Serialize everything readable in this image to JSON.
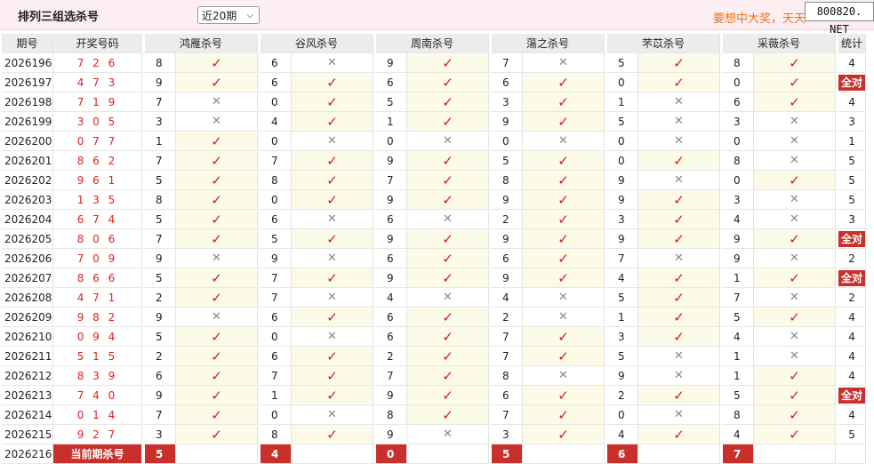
{
  "header": {
    "title": "排列三组选杀号",
    "period": "近20期",
    "slogan": "要想中大奖，天天",
    "watermark": "800820. NET"
  },
  "columns": {
    "issue": "期号",
    "nums": "开奖号码",
    "stat": "统计",
    "methods": [
      "鸿雁杀号",
      "谷风杀号",
      "周南杀号",
      "蕩之杀号",
      "芣苡杀号",
      "采薇杀号"
    ]
  },
  "rows": [
    {
      "issue": "2026196",
      "nums": "7 2 6",
      "k": [
        [
          "8",
          1
        ],
        [
          "6",
          0
        ],
        [
          "9",
          1
        ],
        [
          "7",
          0
        ],
        [
          "5",
          1
        ],
        [
          "8",
          1
        ]
      ],
      "stat": "4"
    },
    {
      "issue": "2026197",
      "nums": "4 7 3",
      "k": [
        [
          "9",
          1
        ],
        [
          "6",
          1
        ],
        [
          "6",
          1
        ],
        [
          "6",
          1
        ],
        [
          "0",
          1
        ],
        [
          "0",
          1
        ]
      ],
      "stat": "全对"
    },
    {
      "issue": "2026198",
      "nums": "7 1 9",
      "k": [
        [
          "7",
          0
        ],
        [
          "0",
          1
        ],
        [
          "5",
          1
        ],
        [
          "3",
          1
        ],
        [
          "1",
          0
        ],
        [
          "6",
          1
        ]
      ],
      "stat": "4"
    },
    {
      "issue": "2026199",
      "nums": "3 0 5",
      "k": [
        [
          "3",
          0
        ],
        [
          "4",
          1
        ],
        [
          "1",
          1
        ],
        [
          "9",
          1
        ],
        [
          "5",
          0
        ],
        [
          "3",
          0
        ]
      ],
      "stat": "3"
    },
    {
      "issue": "2026200",
      "nums": "0 7 7",
      "k": [
        [
          "1",
          1
        ],
        [
          "0",
          0
        ],
        [
          "0",
          0
        ],
        [
          "0",
          0
        ],
        [
          "0",
          0
        ],
        [
          "0",
          0
        ]
      ],
      "stat": "1"
    },
    {
      "issue": "2026201",
      "nums": "8 6 2",
      "k": [
        [
          "7",
          1
        ],
        [
          "7",
          1
        ],
        [
          "9",
          1
        ],
        [
          "5",
          1
        ],
        [
          "0",
          1
        ],
        [
          "8",
          0
        ]
      ],
      "stat": "5"
    },
    {
      "issue": "2026202",
      "nums": "9 6 1",
      "k": [
        [
          "5",
          1
        ],
        [
          "8",
          1
        ],
        [
          "7",
          1
        ],
        [
          "8",
          1
        ],
        [
          "9",
          0
        ],
        [
          "0",
          1
        ]
      ],
      "stat": "5"
    },
    {
      "issue": "2026203",
      "nums": "1 3 5",
      "k": [
        [
          "8",
          1
        ],
        [
          "0",
          1
        ],
        [
          "9",
          1
        ],
        [
          "9",
          1
        ],
        [
          "9",
          1
        ],
        [
          "3",
          0
        ]
      ],
      "stat": "5"
    },
    {
      "issue": "2026204",
      "nums": "6 7 4",
      "k": [
        [
          "5",
          1
        ],
        [
          "6",
          0
        ],
        [
          "6",
          0
        ],
        [
          "2",
          1
        ],
        [
          "3",
          1
        ],
        [
          "4",
          0
        ]
      ],
      "stat": "3"
    },
    {
      "issue": "2026205",
      "nums": "8 0 6",
      "k": [
        [
          "7",
          1
        ],
        [
          "5",
          1
        ],
        [
          "9",
          1
        ],
        [
          "9",
          1
        ],
        [
          "9",
          1
        ],
        [
          "9",
          1
        ]
      ],
      "stat": "全对"
    },
    {
      "issue": "2026206",
      "nums": "7 0 9",
      "k": [
        [
          "9",
          0
        ],
        [
          "9",
          0
        ],
        [
          "6",
          1
        ],
        [
          "6",
          1
        ],
        [
          "7",
          0
        ],
        [
          "9",
          0
        ]
      ],
      "stat": "2"
    },
    {
      "issue": "2026207",
      "nums": "8 6 6",
      "k": [
        [
          "5",
          1
        ],
        [
          "7",
          1
        ],
        [
          "9",
          1
        ],
        [
          "9",
          1
        ],
        [
          "4",
          1
        ],
        [
          "1",
          1
        ]
      ],
      "stat": "全对"
    },
    {
      "issue": "2026208",
      "nums": "4 7 1",
      "k": [
        [
          "2",
          1
        ],
        [
          "7",
          0
        ],
        [
          "4",
          0
        ],
        [
          "4",
          0
        ],
        [
          "5",
          1
        ],
        [
          "7",
          0
        ]
      ],
      "stat": "2"
    },
    {
      "issue": "2026209",
      "nums": "9 8 2",
      "k": [
        [
          "9",
          0
        ],
        [
          "6",
          1
        ],
        [
          "6",
          1
        ],
        [
          "2",
          0
        ],
        [
          "1",
          1
        ],
        [
          "5",
          1
        ]
      ],
      "stat": "4"
    },
    {
      "issue": "2026210",
      "nums": "0 9 4",
      "k": [
        [
          "5",
          1
        ],
        [
          "0",
          0
        ],
        [
          "6",
          1
        ],
        [
          "7",
          1
        ],
        [
          "3",
          1
        ],
        [
          "4",
          0
        ]
      ],
      "stat": "4"
    },
    {
      "issue": "2026211",
      "nums": "5 1 5",
      "k": [
        [
          "2",
          1
        ],
        [
          "6",
          1
        ],
        [
          "2",
          1
        ],
        [
          "7",
          1
        ],
        [
          "5",
          0
        ],
        [
          "1",
          0
        ]
      ],
      "stat": "4"
    },
    {
      "issue": "2026212",
      "nums": "8 3 9",
      "k": [
        [
          "6",
          1
        ],
        [
          "7",
          1
        ],
        [
          "7",
          1
        ],
        [
          "8",
          0
        ],
        [
          "9",
          0
        ],
        [
          "1",
          1
        ]
      ],
      "stat": "4"
    },
    {
      "issue": "2026213",
      "nums": "7 4 0",
      "k": [
        [
          "9",
          1
        ],
        [
          "1",
          1
        ],
        [
          "9",
          1
        ],
        [
          "6",
          1
        ],
        [
          "2",
          1
        ],
        [
          "5",
          1
        ]
      ],
      "stat": "全对"
    },
    {
      "issue": "2026214",
      "nums": "0 1 4",
      "k": [
        [
          "7",
          1
        ],
        [
          "0",
          0
        ],
        [
          "8",
          1
        ],
        [
          "7",
          1
        ],
        [
          "0",
          0
        ],
        [
          "8",
          1
        ]
      ],
      "stat": "4"
    },
    {
      "issue": "2026215",
      "nums": "9 2 7",
      "k": [
        [
          "3",
          1
        ],
        [
          "8",
          1
        ],
        [
          "9",
          0
        ],
        [
          "3",
          1
        ],
        [
          "4",
          1
        ],
        [
          "4",
          1
        ]
      ],
      "stat": "5"
    }
  ],
  "current": {
    "issue": "2026216",
    "label": "当前期杀号",
    "k": [
      "5",
      "4",
      "0",
      "5",
      "6",
      "7"
    ]
  },
  "symbols": {
    "ok": "✓",
    "no": "✕"
  }
}
